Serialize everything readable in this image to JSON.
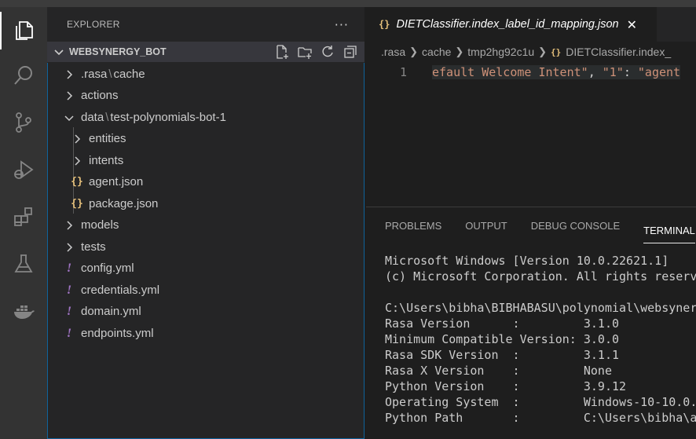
{
  "explorer": {
    "title": "EXPLORER",
    "more": "···",
    "folder": "WEBSYNERGY_BOT",
    "tree": [
      {
        "label_parts": [
          ".rasa",
          "cache"
        ],
        "type": "folder",
        "expanded": false
      },
      {
        "label": "actions",
        "type": "folder",
        "expanded": false
      },
      {
        "label_parts": [
          "data",
          "test-polynomials-bot-1"
        ],
        "type": "folder",
        "expanded": true
      },
      {
        "label": "entities",
        "type": "folder",
        "expanded": false
      },
      {
        "label": "intents",
        "type": "folder",
        "expanded": false
      },
      {
        "label": "agent.json",
        "type": "json"
      },
      {
        "label": "package.json",
        "type": "json"
      },
      {
        "label": "models",
        "type": "folder",
        "expanded": false
      },
      {
        "label": "tests",
        "type": "folder",
        "expanded": false
      },
      {
        "label": "config.yml",
        "type": "yml"
      },
      {
        "label": "credentials.yml",
        "type": "yml"
      },
      {
        "label": "domain.yml",
        "type": "yml"
      },
      {
        "label": "endpoints.yml",
        "type": "yml"
      }
    ]
  },
  "editor": {
    "tab_icon": "{}",
    "tab_label": "DIETClassifier.index_label_id_mapping.json",
    "breadcrumb": [
      ".rasa",
      "cache",
      "tmp2hg92c1u",
      "DIETClassifier.index_"
    ],
    "line_number": "1",
    "code": {
      "s1": "efault Welcome Intent\"",
      "p1": ", ",
      "k1": "\"1\"",
      "p2": ": ",
      "s2": "\"agent"
    }
  },
  "panel": {
    "tabs": [
      "PROBLEMS",
      "OUTPUT",
      "DEBUG CONSOLE",
      "TERMINAL"
    ],
    "active_tab": "TERMINAL",
    "terminal_lines": [
      "Microsoft Windows [Version 10.0.22621.1]",
      "(c) Microsoft Corporation. All rights reserv",
      "",
      "C:\\Users\\bibha\\BIBHABASU\\polynomial\\websyner",
      "Rasa Version      :         3.1.0",
      "Minimum Compatible Version: 3.0.0",
      "Rasa SDK Version  :         3.1.1",
      "Rasa X Version    :         None",
      "Python Version    :         3.9.12",
      "Operating System  :         Windows-10-10.0.",
      "Python Path       :         C:\\Users\\bibha\\a"
    ]
  },
  "colors": {
    "accent": "#0e639c",
    "json_icon": "#e5c07b",
    "yml_icon": "#a074c4"
  },
  "icons": {
    "activity": [
      "files-icon",
      "search-icon",
      "source-control-icon",
      "run-debug-icon",
      "extensions-icon",
      "testing-icon",
      "docker-icon"
    ]
  }
}
